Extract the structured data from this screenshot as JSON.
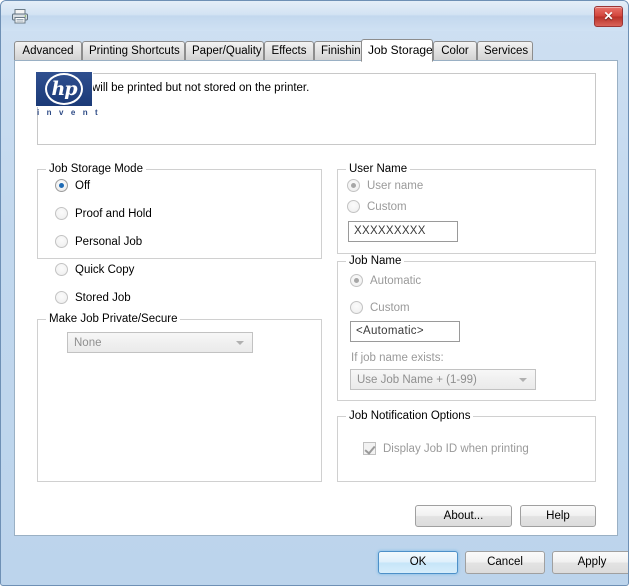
{
  "window": {
    "icon": "printer-icon",
    "close_label": "✕",
    "frame_color": "#c2d8ee"
  },
  "tabs": [
    {
      "label": "Advanced",
      "active": false
    },
    {
      "label": "Printing Shortcuts",
      "active": false
    },
    {
      "label": "Paper/Quality",
      "active": false
    },
    {
      "label": "Effects",
      "active": false
    },
    {
      "label": "Finishing",
      "active": false
    },
    {
      "label": "Job Storage",
      "active": true
    },
    {
      "label": "Color",
      "active": false
    },
    {
      "label": "Services",
      "active": false
    }
  ],
  "message": {
    "text": "Your job will be printed but not stored on the printer."
  },
  "job_storage_mode": {
    "title": "Job Storage Mode",
    "options": [
      {
        "label": "Off",
        "checked": true
      },
      {
        "label": "Proof and Hold",
        "checked": false
      },
      {
        "label": "Personal Job",
        "checked": false
      },
      {
        "label": "Quick Copy",
        "checked": false
      },
      {
        "label": "Stored Job",
        "checked": false
      }
    ]
  },
  "make_job_private": {
    "title": "Make Job Private/Secure",
    "selected": "None",
    "options": [
      "None"
    ]
  },
  "user_name": {
    "title": "User Name",
    "options": [
      {
        "label": "User name",
        "checked": true
      },
      {
        "label": "Custom",
        "checked": false
      }
    ],
    "custom_value": "XXXXXXXXX"
  },
  "job_name": {
    "title": "Job Name",
    "options": [
      {
        "label": "Automatic",
        "checked": true
      },
      {
        "label": "Custom",
        "checked": false
      }
    ],
    "custom_value": "<Automatic>",
    "if_exists_label": "If job name exists:",
    "if_exists_selected": "Use Job Name + (1-99)",
    "if_exists_options": [
      "Use Job Name + (1-99)"
    ]
  },
  "job_notification": {
    "title": "Job Notification Options",
    "display_job_id_label": "Display Job ID when printing",
    "display_job_id_checked": true
  },
  "branding": {
    "logo_text": "hp",
    "tagline": "i n v e n t"
  },
  "help_buttons": {
    "about": "About...",
    "help": "Help"
  },
  "footer_buttons": {
    "ok": "OK",
    "cancel": "Cancel",
    "apply": "Apply"
  },
  "colors": {
    "accent": "#1f6bb5",
    "close_red": "#d2453c",
    "hp_blue": "#1b3a77"
  }
}
